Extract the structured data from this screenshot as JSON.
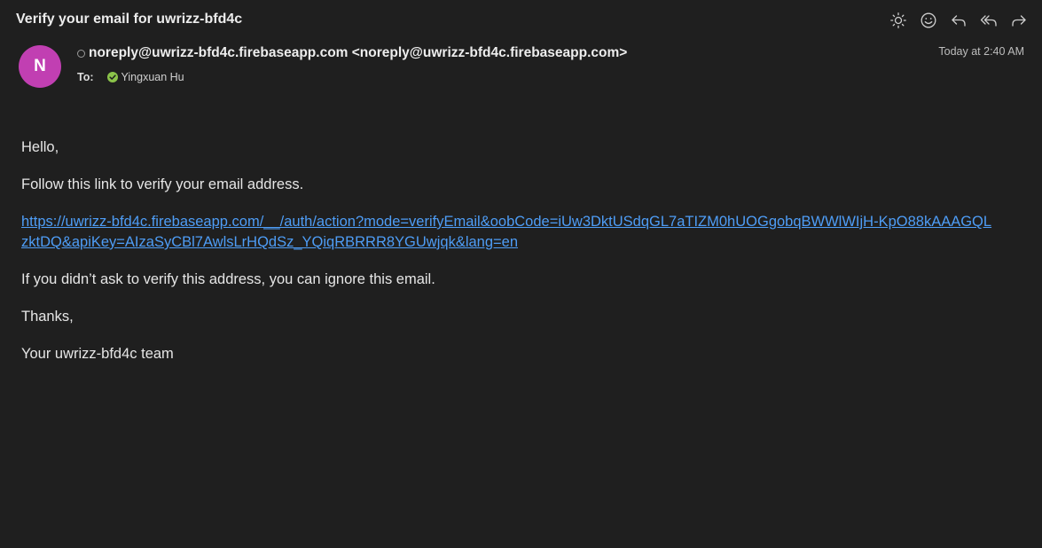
{
  "email": {
    "subject": "Verify your email for uwrizz-bfd4c",
    "avatar_initial": "N",
    "avatar_color": "#c13fb2",
    "from": "noreply@uwrizz-bfd4c.firebaseapp.com <noreply@uwrizz-bfd4c.firebaseapp.com>",
    "date": "Today at 2:40 AM",
    "to_label": "To:",
    "recipient": "Yingxuan Hu"
  },
  "toolbar": {
    "icons": [
      "brightness-icon",
      "emoji-icon",
      "reply-icon",
      "reply-all-icon",
      "forward-icon"
    ]
  },
  "body": {
    "greeting": "Hello,",
    "instruction": "Follow this link to verify your email address.",
    "link": "https://uwrizz-bfd4c.firebaseapp.com/__/auth/action?mode=verifyEmail&oobCode=iUw3DktUSdqGL7aTIZM0hUOGgobqBWWlWIjH-KpO88kAAAGQLzktDQ&apiKey=AIzaSyCBl7AwlsLrHQdSz_YQiqRBRRR8YGUwjqk&lang=en",
    "ignore_note": "If you didn’t ask to verify this address, you can ignore this email.",
    "thanks": "Thanks,",
    "signature": "Your uwrizz-bfd4c team"
  },
  "colors": {
    "background": "#1f1f1f",
    "link": "#4e9df6",
    "verified": "#8bc34a"
  }
}
